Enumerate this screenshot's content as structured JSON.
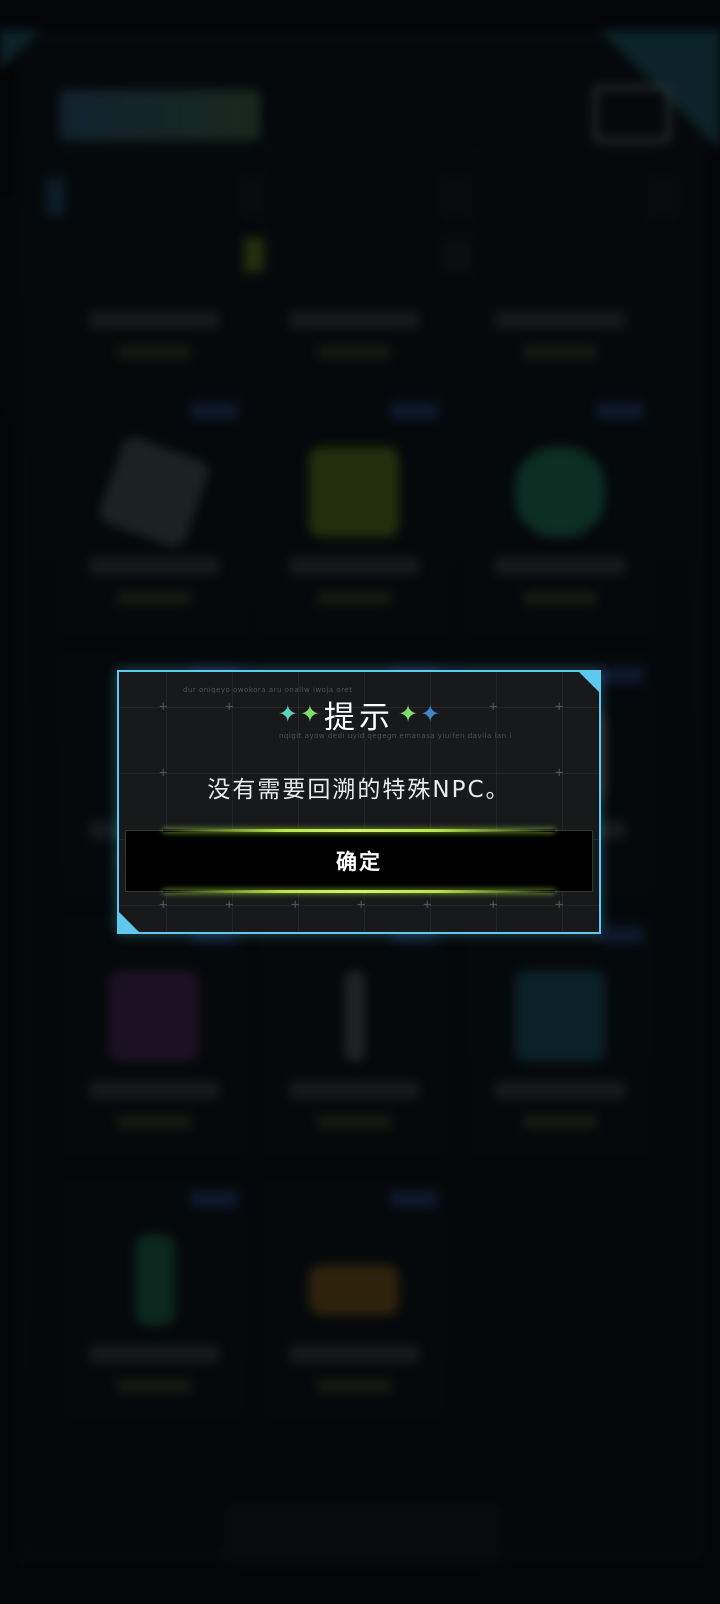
{
  "dialog": {
    "title": "提示",
    "message": "没有需要回溯的特殊NPC。",
    "confirm_label": "确定",
    "deco_line_1": "dur oniqeyo owokora aru onallw iwoja oret",
    "deco_line_2": "nqigit ayow dedi uyid qegegn emanasa yiuifen davila lan i"
  },
  "colors": {
    "dialog_border": "#5fc8ef",
    "button_glow": "#b8e64a",
    "dialog_bg": "#17191b"
  },
  "icons": {
    "title_left_stars": [
      "sparkle-teal-icon",
      "sparkle-green-icon"
    ],
    "title_right_stars": [
      "sparkle-green-icon",
      "sparkle-blue-icon"
    ]
  }
}
